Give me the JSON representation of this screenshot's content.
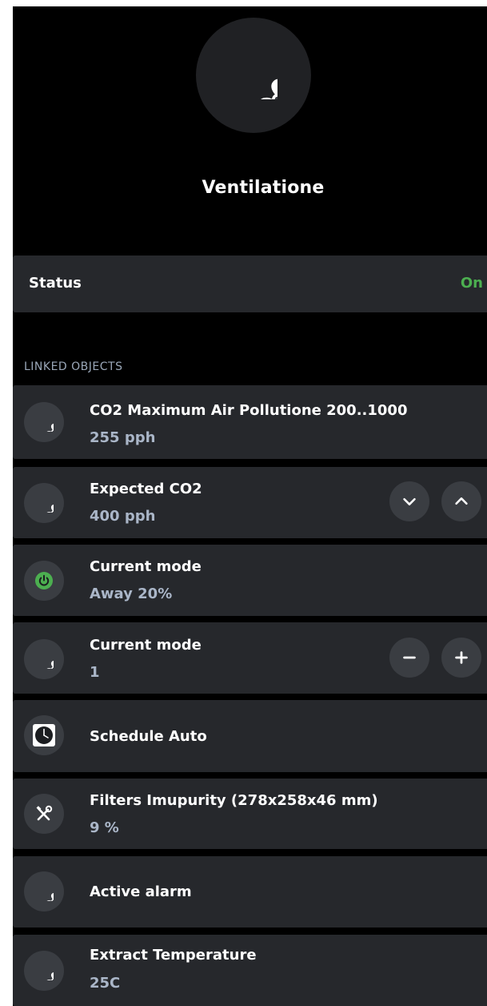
{
  "device": {
    "title": "Ventilatione",
    "icon": "fan-icon"
  },
  "status": {
    "label": "Status",
    "value": "On",
    "value_color": "#4caf50"
  },
  "linked_objects": {
    "header": "LINKED OBJECTS",
    "items": [
      {
        "icon": "fan-icon",
        "name": "CO2 Maximum Air Pollutione 200..1000",
        "value": "255 pph"
      },
      {
        "icon": "fan-icon",
        "name": "Expected CO2",
        "value": "400 pph",
        "controls": [
          "chevron-down-icon",
          "chevron-up-icon"
        ]
      },
      {
        "icon": "power-icon",
        "name": "Current mode",
        "value": "Away 20%"
      },
      {
        "icon": "fan-icon",
        "name": "Current mode",
        "value": "1",
        "controls": [
          "minus-icon",
          "plus-icon"
        ]
      },
      {
        "icon": "clock-icon",
        "name": "Schedule Auto"
      },
      {
        "icon": "tools-icon",
        "name": "Filters Imupurity (278x258x46 mm)",
        "value": "9 %"
      },
      {
        "icon": "fan-icon",
        "name": "Active alarm"
      },
      {
        "icon": "fan-icon",
        "name": "Extract Temperature",
        "value": "25C"
      }
    ]
  }
}
